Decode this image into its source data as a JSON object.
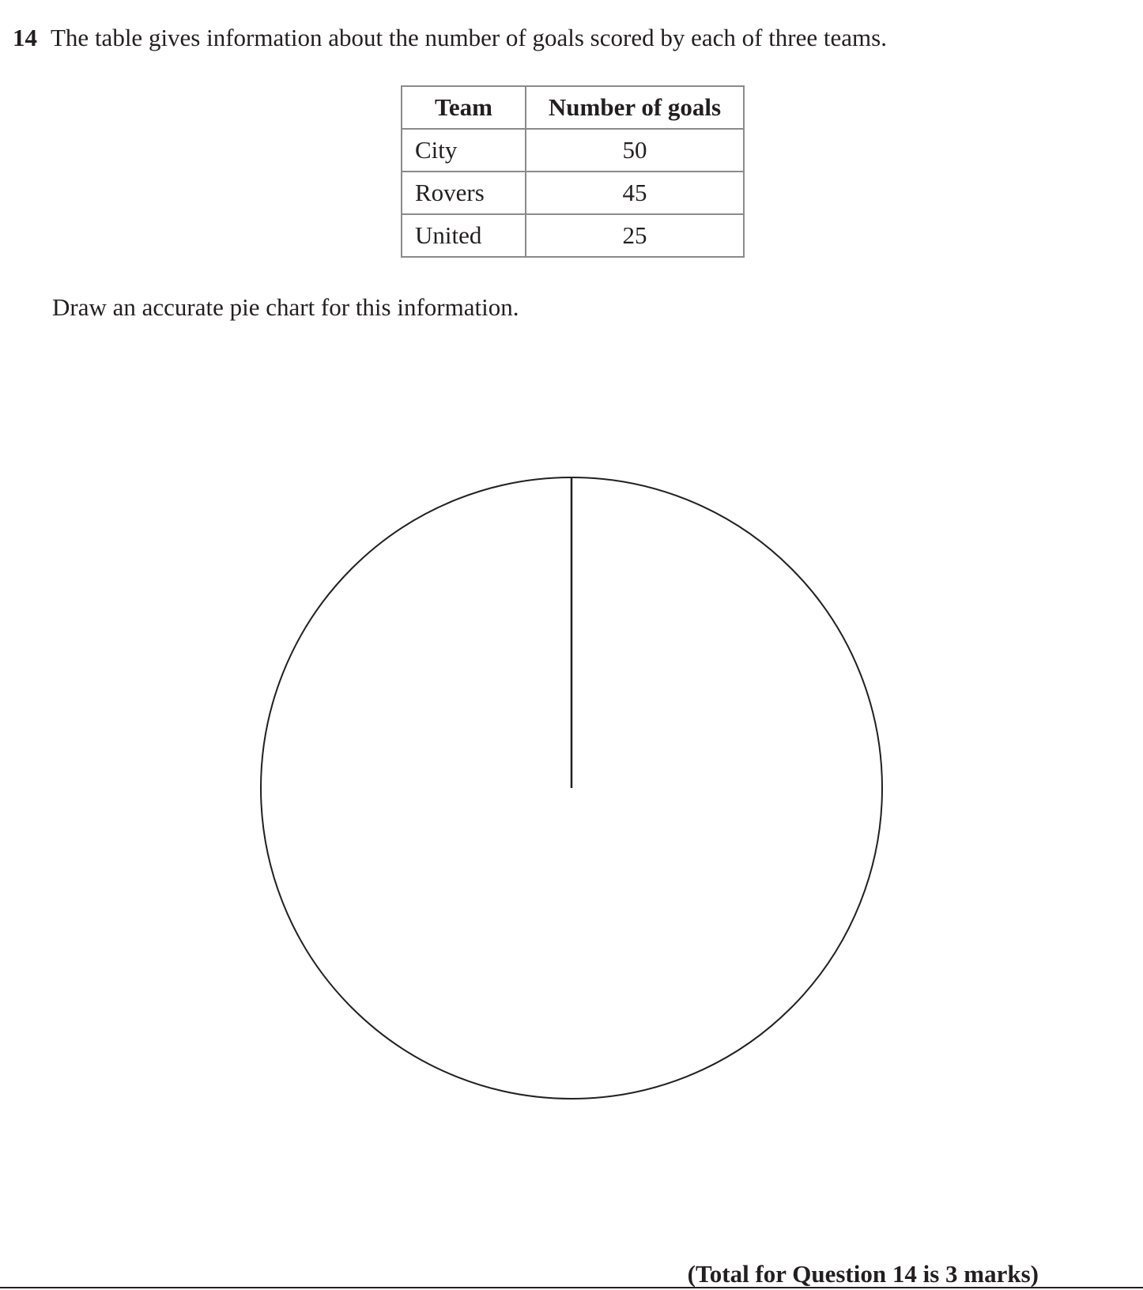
{
  "question": {
    "number": "14",
    "text": "The table gives information about the number of goals scored by each of three teams."
  },
  "table": {
    "headers": [
      "Team",
      "Number of goals"
    ],
    "rows": [
      {
        "team": "City",
        "goals": "50"
      },
      {
        "team": "Rovers",
        "goals": "45"
      },
      {
        "team": "United",
        "goals": "25"
      }
    ]
  },
  "instruction": "Draw an accurate pie chart for this information.",
  "total": "(Total for Question 14 is 3 marks)"
}
